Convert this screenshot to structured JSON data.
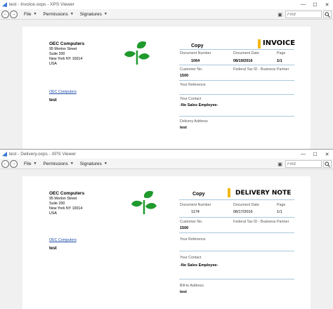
{
  "colors": {
    "accent_bar": "#f2b817",
    "link": "#1a4aa8",
    "rule": "#a8c8dc",
    "leaf": "#1f9a2c"
  },
  "toolbar": {
    "file": "File",
    "permissions": "Permissions",
    "signatures": "Signatures",
    "find_placeholder": "Find"
  },
  "window1": {
    "title": "test - Invoice.oxps - XPS Viewer",
    "doc": {
      "company": {
        "name": "OEC Computers",
        "street": "95 Morton Street",
        "suite": "Suite 200",
        "city": "New York NY  10014",
        "country": "USA"
      },
      "web_link": "OEC Computers",
      "customer_name": "test",
      "copy_label": "Copy",
      "doc_title": "INVOICE",
      "doc_number_label": "Document Number",
      "doc_number": "1064",
      "doc_date_label": "Document Date",
      "doc_date": "08/19/2016",
      "page_label": "Page",
      "page": "1/1",
      "customer_no_label": "Customer No.",
      "customer_no": "1500",
      "tax_label": "Federal Tax ID - Business Partner",
      "reference_label": "Your Reference",
      "contact_label": "Your Contact",
      "contact": "-No Sales Employee-",
      "address_label": "Delivery Address",
      "address": "test"
    }
  },
  "window2": {
    "title": "test - Delivery.oxps - XPS Viewer",
    "doc": {
      "company": {
        "name": "OEC Computers",
        "street": "95 Morton Street",
        "suite": "Suite 200",
        "city": "New York NY  10014",
        "country": "USA"
      },
      "web_link": "OEC Computers",
      "customer_name": "test",
      "copy_label": "Copy",
      "doc_title": "DELIVERY NOTE",
      "doc_number_label": "Document Number",
      "doc_number": "1174",
      "doc_date_label": "Document Date",
      "doc_date": "08/17/2016",
      "page_label": "Page",
      "page": "1/1",
      "customer_no_label": "Customer No.",
      "customer_no": "1500",
      "tax_label": "Federal Tax ID - Business Partner",
      "reference_label": "Your Reference",
      "contact_label": "Your Contact",
      "contact": "-No Sales Employee-",
      "address_label": "Bill-to Address",
      "address": "test"
    }
  }
}
